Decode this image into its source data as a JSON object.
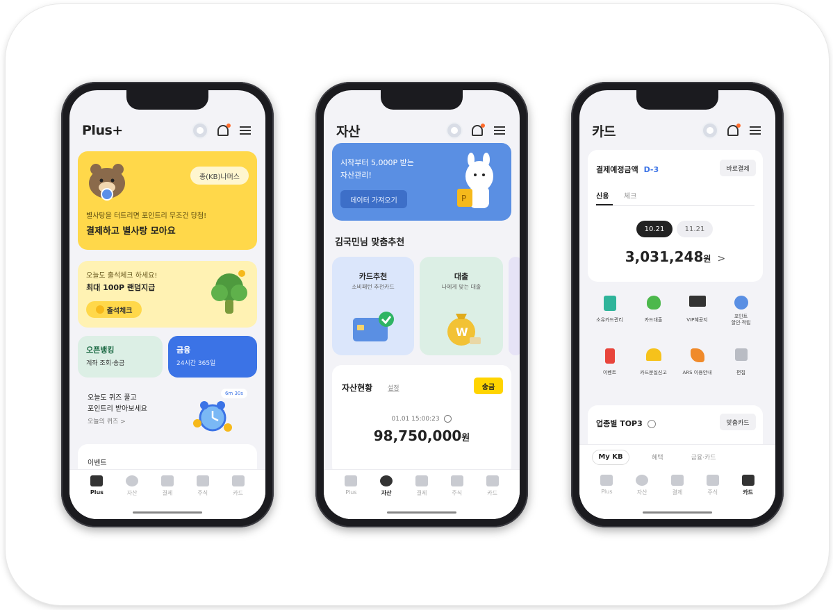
{
  "phone1": {
    "title": "Plus+",
    "banner": {
      "badge": "종(KB)나머스",
      "sub": "별사탕을 터트리면 포인트리 무조건 당첨!",
      "main": "결제하고 별사탕 모아요"
    },
    "attendance": {
      "sub": "오늘도 출석체크 하세요!",
      "main": "최대 100P 랜덤지급",
      "button": "출석체크"
    },
    "tile_open": {
      "title": "오픈뱅킹",
      "sub": "계좌 조회·송금"
    },
    "tile_finance": {
      "title": "금융",
      "sub": "24시간 365일"
    },
    "quiz": {
      "line1": "오늘도 퀴즈 풀고",
      "line2": "포인트리 받아보세요",
      "link": "오늘의 퀴즈 >",
      "tag": "6m 30s"
    },
    "event_label": "이벤트",
    "tabs": [
      "Plus",
      "자산",
      "결제",
      "주식",
      "카드"
    ]
  },
  "phone2": {
    "title": "자산",
    "banner": {
      "line1": "시작부터 5,000P 받는",
      "line2": "자산관리!",
      "button": "데이터 가져오기"
    },
    "recommend_title": "김국민님 맞춤추천",
    "rec_card": {
      "title": "카드추천",
      "sub": "소비패턴 추천카드"
    },
    "rec_loan": {
      "title": "대출",
      "sub": "나에게 맞는 대출"
    },
    "asset": {
      "title": "자산현황",
      "setting": "설정",
      "button": "송금",
      "time": "01.01 15:00:23",
      "amount": "98,750,000",
      "unit": "원"
    },
    "tabs": [
      "Plus",
      "자산",
      "결제",
      "주식",
      "카드"
    ]
  },
  "phone3": {
    "title": "카드",
    "payment": {
      "title": "결제예정금액",
      "dday": "D-3",
      "button": "바로결제",
      "tab_credit": "신용",
      "tab_check": "체크",
      "date1": "10.21",
      "date2": "11.21",
      "amount": "3,031,248",
      "unit": "원",
      "chevron": ">"
    },
    "menu": [
      "소유카드관리",
      "카드대출",
      "VIP혜공지",
      "포인트\n할인·적립",
      "이벤트",
      "카드분실신고",
      "ARS 이용안내",
      "편집"
    ],
    "top3": {
      "title": "업종별 TOP3",
      "button": "맞춤카드"
    },
    "segments": [
      "My KB",
      "혜택",
      "금융·카드"
    ],
    "tabs": [
      "Plus",
      "자산",
      "결제",
      "주식",
      "카드"
    ]
  }
}
